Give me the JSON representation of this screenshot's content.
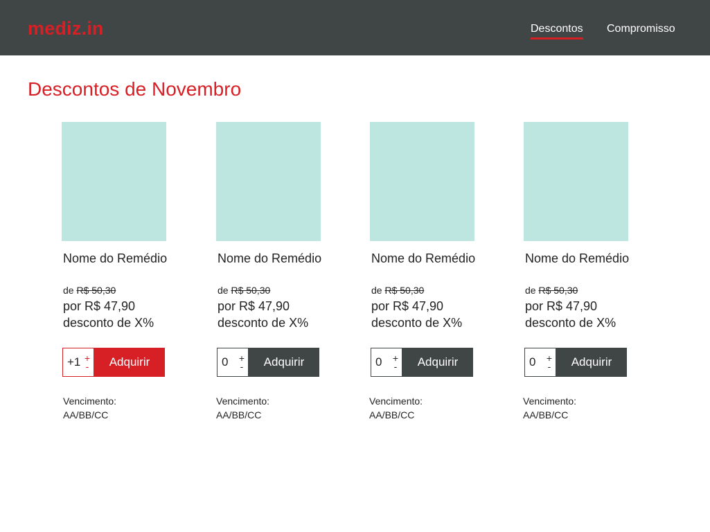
{
  "header": {
    "logo": "mediz.in",
    "nav": [
      {
        "label": "Descontos",
        "active": true
      },
      {
        "label": "Compromisso",
        "active": false
      }
    ]
  },
  "page": {
    "title": "Descontos de Novembro"
  },
  "colors": {
    "brand_red": "#d71f26",
    "header_bg": "#404546",
    "image_placeholder": "#bde6e0"
  },
  "products": [
    {
      "name": "Nome do Remédio",
      "old_prefix": "de",
      "old_price": "R$ 50,30",
      "new_price": "por R$ 47,90",
      "discount": "desconto de X%",
      "quantity": "+1",
      "plus": "+",
      "minus": "-",
      "buy_label": "Adquirir",
      "expiry_label": "Vencimento:",
      "expiry_date": "AA/BB/CC",
      "active": true
    },
    {
      "name": "Nome do Remédio",
      "old_prefix": "de",
      "old_price": "R$ 50,30",
      "new_price": "por R$ 47,90",
      "discount": "desconto de X%",
      "quantity": "0",
      "plus": "+",
      "minus": "-",
      "buy_label": "Adquirir",
      "expiry_label": "Vencimento:",
      "expiry_date": "AA/BB/CC",
      "active": false
    },
    {
      "name": "Nome do Remédio",
      "old_prefix": "de",
      "old_price": "R$ 50,30",
      "new_price": "por R$ 47,90",
      "discount": "desconto de X%",
      "quantity": "0",
      "plus": "+",
      "minus": "-",
      "buy_label": "Adquirir",
      "expiry_label": "Vencimento:",
      "expiry_date": "AA/BB/CC",
      "active": false
    },
    {
      "name": "Nome do Remédio",
      "old_prefix": "de",
      "old_price": "R$ 50,30",
      "new_price": "por R$ 47,90",
      "discount": "desconto de X%",
      "quantity": "0",
      "plus": "+",
      "minus": "-",
      "buy_label": "Adquirir",
      "expiry_label": "Vencimento:",
      "expiry_date": "AA/BB/CC",
      "active": false
    }
  ]
}
